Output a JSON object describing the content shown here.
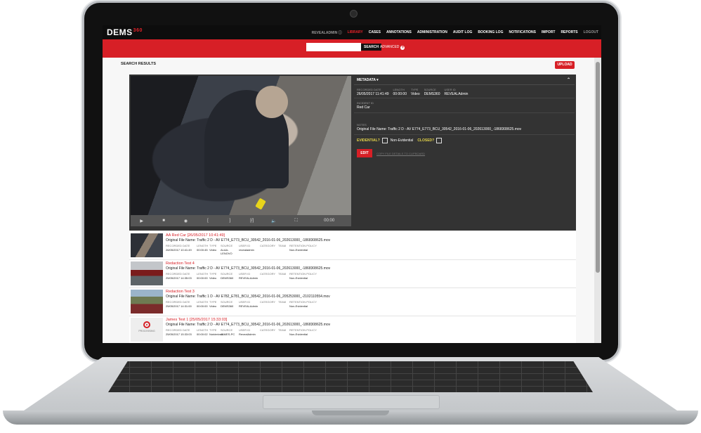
{
  "app": {
    "brand": "DEMS",
    "brand_sup": "360",
    "user": "REVEALADMIN",
    "nav": [
      "LIBRARY",
      "CASES",
      "ANNOTATIONS",
      "ADMINISTRATION",
      "AUDIT LOG",
      "BOOKING LOG",
      "NOTIFICATIONS",
      "IMPORT",
      "REPORTS"
    ],
    "logout": "LOGOUT"
  },
  "search": {
    "placeholder": "",
    "button": "SEARCH",
    "advanced": "ADVANCED"
  },
  "page": {
    "title": "SEARCH RESULTS",
    "upload": "UPLOAD"
  },
  "player": {
    "controls": [
      "▶",
      "■",
      "◉",
      "[",
      "]",
      "[/]",
      "🔈",
      "⛶"
    ],
    "time": "00:00"
  },
  "metadata": {
    "header": "METADATA",
    "fields": [
      {
        "label": "RECORDED DATE",
        "value": "26/05/2017 11:41:49"
      },
      {
        "label": "LENGTH",
        "value": "00:00:00"
      },
      {
        "label": "TYPE",
        "value": "Video"
      },
      {
        "label": "SOURCE",
        "value": "DEMS360"
      },
      {
        "label": "USER ID",
        "value": "REVEALAdmin"
      }
    ],
    "incident_label": "INCIDENT ID",
    "incident_value": "Red Car",
    "notes_label": "NOTES",
    "notes_value": "Original File Name: Traffic 2 D - AV E774_E773_BCU_30542_2016-01-06_202613000_-1868308625.mov",
    "evidential_label": "EVIDENTIAL?",
    "evidential_value": "Non-Evidential",
    "closed_label": "CLOSED?",
    "edit": "EDIT",
    "copy_link": "COPY FILE DETAILS TO CLIPBOARD"
  },
  "results": [
    {
      "title": "AA Red Car [26/05/2017 10:41:49]",
      "file": "Original File Name: Traffic 2 D - AV E774_E773_BCU_30542_2016-01-06_202613000_-1868308625.mov",
      "labels": [
        "RECORDED DATE",
        "LENGTH",
        "TYPE",
        "SOURCE",
        "USER ID",
        "CATEGORY",
        "TEAM",
        "RETENTION POLICY"
      ],
      "values": [
        "26/05/2017 10:41:49",
        "00:00:45",
        "Video",
        "ALAA-LENOVO",
        "revealadmin",
        "",
        "",
        "Non-Evidential"
      ]
    },
    {
      "title": "Redaction Test 4",
      "file": "Original File Name: Traffic 2 D - AV E774_E773_BCU_30542_2016-01-06_202613000_-1868308625.mov",
      "labels": [
        "RECORDED DATE",
        "LENGTH",
        "TYPE",
        "SOURCE",
        "USER ID",
        "CATEGORY",
        "TEAM",
        "RETENTION POLICY"
      ],
      "values": [
        "25/05/2017 14:35:03",
        "00:00:00",
        "Video",
        "DEMS360",
        "REVEALAdmin",
        "",
        "",
        "Non-Evidential"
      ]
    },
    {
      "title": "Redaction Test 3",
      "file": "Original File Name: Traffic 1 D - AV E782_E781_BCU_30542_2016-01-06_205253000_-2102110554.mov",
      "labels": [
        "RECORDED DATE",
        "LENGTH",
        "TYPE",
        "SOURCE",
        "USER ID",
        "CATEGORY",
        "TEAM",
        "RETENTION POLICY"
      ],
      "values": [
        "25/05/2017 14:31:00",
        "00:00:00",
        "Video",
        "DEMS360",
        "REVEALAdmin",
        "",
        "",
        "Non-Evidential"
      ]
    },
    {
      "title": "James Test 1 [25/05/2017 15:33:03]",
      "file": "Original File Name: Traffic 2 D - AV E774_E773_BCU_30542_2016-01-06_202613000_-1868308625.mov",
      "labels": [
        "RECORDED DATE",
        "LENGTH",
        "TYPE",
        "SOURCE",
        "USER ID",
        "CATEGORY",
        "TEAM",
        "RETENTION POLICY"
      ],
      "values": [
        "25/05/2017 15:33:03",
        "00:00:02",
        "Notderived",
        "JAMES-PC",
        "RevealAdmin",
        "",
        "",
        "Non-Evidential"
      ],
      "processing": "PROCESSING"
    }
  ],
  "colors": {
    "brand_red": "#d71f26",
    "topbar": "#0d0d0d",
    "panel": "#333333"
  }
}
